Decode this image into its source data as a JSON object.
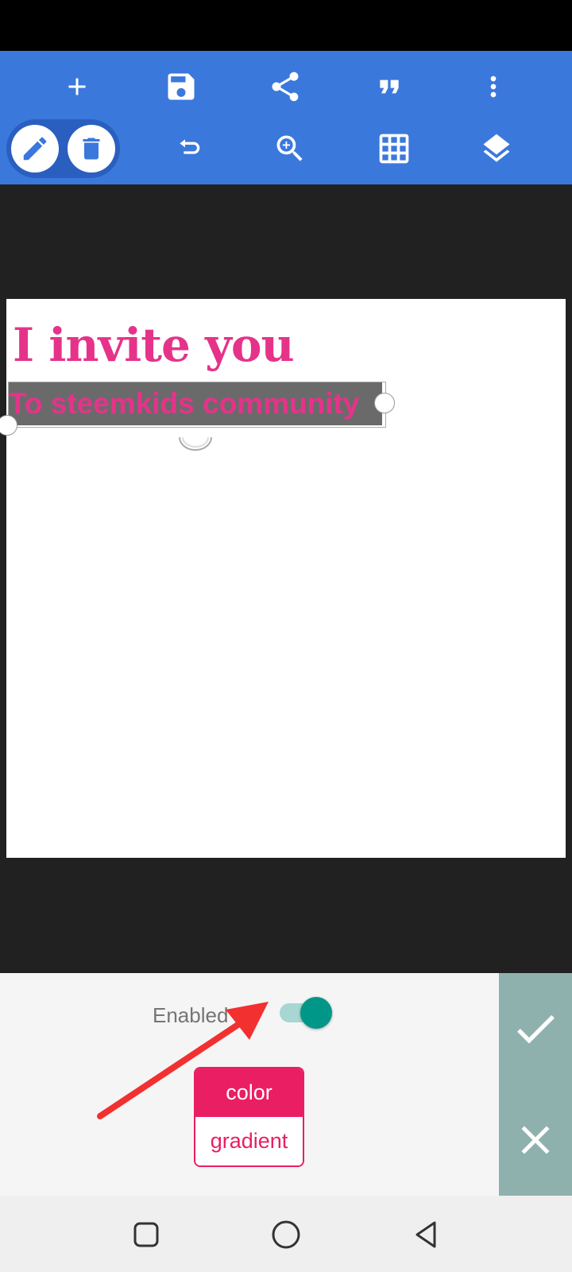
{
  "toolbar": {
    "top_row": [
      "add-icon",
      "save-icon",
      "share-icon",
      "quote-icon",
      "more-vert-icon"
    ],
    "bottom_row": [
      "edit-icon",
      "delete-icon",
      "undo-icon",
      "zoom-in-icon",
      "grid-icon",
      "layers-icon"
    ]
  },
  "canvas": {
    "title": "I invite you",
    "subtitle": "To steemkids community",
    "text_color": "#e5338a",
    "highlight_color": "#6a6a6a"
  },
  "panel": {
    "enabled_label": "Enabled :",
    "enabled": true,
    "options": [
      "color",
      "gradient"
    ],
    "selected": "color",
    "accent": "#e91e63",
    "switch_color": "#009688"
  },
  "actions": {
    "confirm_icon": "check-icon",
    "cancel_icon": "close-icon"
  },
  "nav": {
    "icons": [
      "recent-apps-icon",
      "home-icon",
      "back-icon"
    ]
  },
  "colors": {
    "toolbar": "#3a78dc",
    "workspace": "#212121",
    "actions_bg": "#8fb1ad"
  }
}
